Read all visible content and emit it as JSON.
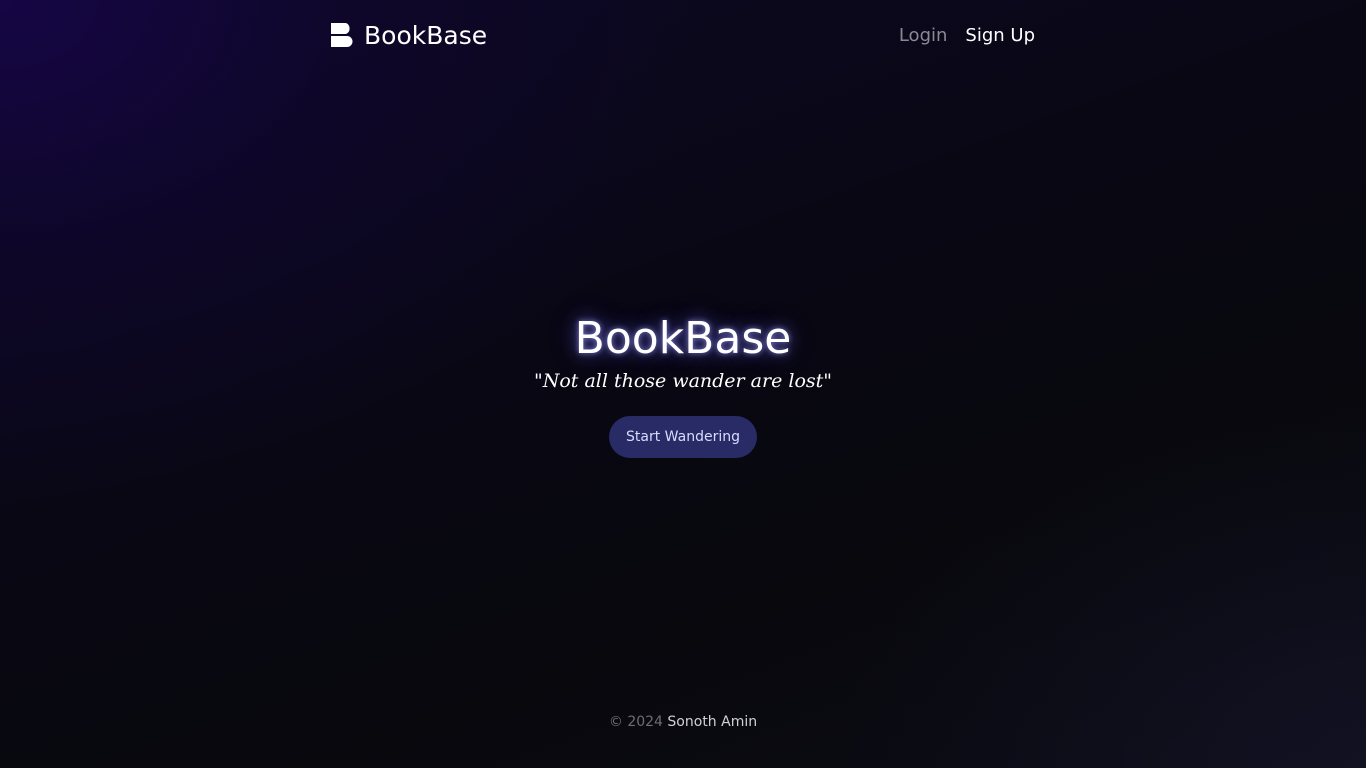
{
  "header": {
    "brand": {
      "icon": "bookbase-logo-icon",
      "name": "BookBase"
    },
    "nav": {
      "login_label": "Login",
      "signup_label": "Sign Up"
    }
  },
  "hero": {
    "title": "BookBase",
    "quote": "\"Not all those wander are lost\"",
    "cta_label": "Start Wandering"
  },
  "footer": {
    "copyright": "© 2024",
    "author": "Sonoth Amin"
  },
  "colors": {
    "background": "#0a0813",
    "accent_button": "#282b66",
    "nav_inactive": "#8a8a93",
    "text": "#ffffff"
  }
}
